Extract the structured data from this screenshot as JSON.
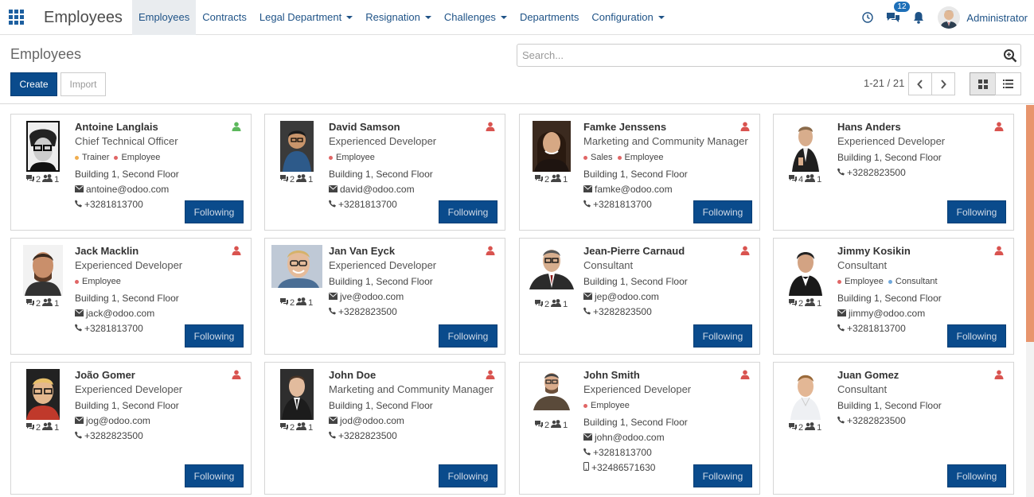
{
  "app": {
    "brand": "Employees"
  },
  "menu": [
    {
      "label": "Employees",
      "caret": false,
      "active": true
    },
    {
      "label": "Contracts",
      "caret": false,
      "active": false
    },
    {
      "label": "Legal Department",
      "caret": true,
      "active": false
    },
    {
      "label": "Resignation",
      "caret": true,
      "active": false
    },
    {
      "label": "Challenges",
      "caret": true,
      "active": false
    },
    {
      "label": "Departments",
      "caret": false,
      "active": false
    },
    {
      "label": "Configuration",
      "caret": true,
      "active": false
    }
  ],
  "systray": {
    "messages_badge": "12",
    "user": "Administrator"
  },
  "control": {
    "title": "Employees",
    "create_label": "Create",
    "import_label": "Import",
    "search_placeholder": "Search...",
    "pager": "1-21 / 21"
  },
  "colors": {
    "primary": "#0a4b8c",
    "online": "#5cb85c",
    "offline": "#d9534f",
    "accent_scroll": "#e8956d"
  },
  "employees": [
    {
      "name": "Antoine Langlais",
      "job": "Chief Technical Officer",
      "tags": [
        {
          "label": "Trainer",
          "color": "#f0ad4e"
        },
        {
          "label": "Employee",
          "color": "#e06666"
        }
      ],
      "location": "Building 1, Second Floor",
      "email": "antoine@odoo.com",
      "phone": "+3281813700",
      "mobile": "",
      "messages": "2",
      "followers": "1",
      "presence": "online",
      "follow_label": "Following"
    },
    {
      "name": "David Samson",
      "job": "Experienced Developer",
      "tags": [
        {
          "label": "Employee",
          "color": "#e06666"
        }
      ],
      "location": "Building 1, Second Floor",
      "email": "david@odoo.com",
      "phone": "+3281813700",
      "mobile": "",
      "messages": "2",
      "followers": "1",
      "presence": "offline",
      "follow_label": "Following"
    },
    {
      "name": "Famke Jenssens",
      "job": "Marketing and Community Manager",
      "tags": [
        {
          "label": "Sales",
          "color": "#e06666"
        },
        {
          "label": "Employee",
          "color": "#e06666"
        }
      ],
      "location": "Building 1, Second Floor",
      "email": "famke@odoo.com",
      "phone": "+3281813700",
      "mobile": "",
      "messages": "2",
      "followers": "1",
      "presence": "offline",
      "follow_label": "Following"
    },
    {
      "name": "Hans Anders",
      "job": "Experienced Developer",
      "tags": [],
      "location": "Building 1, Second Floor",
      "email": "",
      "phone": "+3282823500",
      "mobile": "",
      "messages": "4",
      "followers": "1",
      "presence": "offline",
      "follow_label": "Following"
    },
    {
      "name": "Jack Macklin",
      "job": "Experienced Developer",
      "tags": [
        {
          "label": "Employee",
          "color": "#e06666"
        }
      ],
      "location": "Building 1, Second Floor",
      "email": "jack@odoo.com",
      "phone": "+3281813700",
      "mobile": "",
      "messages": "2",
      "followers": "1",
      "presence": "offline",
      "follow_label": "Following"
    },
    {
      "name": "Jan Van Eyck",
      "job": "Experienced Developer",
      "tags": [],
      "location": "Building 1, Second Floor",
      "email": "jve@odoo.com",
      "phone": "+3282823500",
      "mobile": "",
      "messages": "2",
      "followers": "1",
      "presence": "offline",
      "follow_label": "Following"
    },
    {
      "name": "Jean-Pierre Carnaud",
      "job": "Consultant",
      "tags": [],
      "location": "Building 1, Second Floor",
      "email": "jep@odoo.com",
      "phone": "+3282823500",
      "mobile": "",
      "messages": "2",
      "followers": "1",
      "presence": "offline",
      "follow_label": "Following"
    },
    {
      "name": "Jimmy Kosikin",
      "job": "Consultant",
      "tags": [
        {
          "label": "Employee",
          "color": "#e06666"
        },
        {
          "label": "Consultant",
          "color": "#6fa8dc"
        }
      ],
      "location": "Building 1, Second Floor",
      "email": "jimmy@odoo.com",
      "phone": "+3281813700",
      "mobile": "",
      "messages": "2",
      "followers": "1",
      "presence": "offline",
      "follow_label": "Following"
    },
    {
      "name": "João Gomer",
      "job": "Experienced Developer",
      "tags": [],
      "location": "Building 1, Second Floor",
      "email": "jog@odoo.com",
      "phone": "+3282823500",
      "mobile": "",
      "messages": "2",
      "followers": "1",
      "presence": "offline",
      "follow_label": "Following"
    },
    {
      "name": "John Doe",
      "job": "Marketing and Community Manager",
      "tags": [],
      "location": "Building 1, Second Floor",
      "email": "jod@odoo.com",
      "phone": "+3282823500",
      "mobile": "",
      "messages": "2",
      "followers": "1",
      "presence": "offline",
      "follow_label": "Following"
    },
    {
      "name": "John Smith",
      "job": "Experienced Developer",
      "tags": [
        {
          "label": "Employee",
          "color": "#e06666"
        }
      ],
      "location": "Building 1, Second Floor",
      "email": "john@odoo.com",
      "phone": "+3281813700",
      "mobile": "+32486571630",
      "messages": "2",
      "followers": "1",
      "presence": "offline",
      "follow_label": "Following"
    },
    {
      "name": "Juan Gomez",
      "job": "Consultant",
      "tags": [],
      "location": "Building 1, Second Floor",
      "email": "",
      "phone": "+3282823500",
      "mobile": "",
      "messages": "2",
      "followers": "1",
      "presence": "offline",
      "follow_label": "Following"
    }
  ]
}
